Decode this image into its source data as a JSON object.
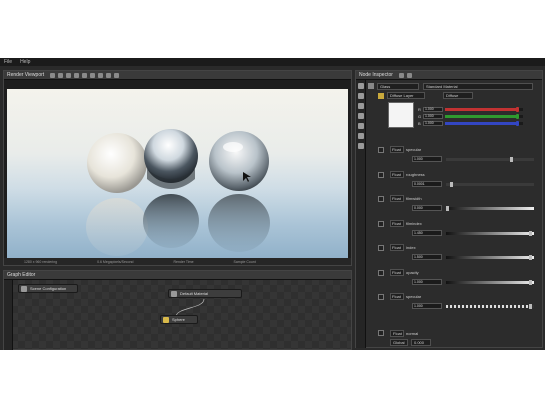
{
  "menu": {
    "items": [
      "File",
      "Help"
    ]
  },
  "viewer": {
    "title": "Render Viewport",
    "status": [
      "1280 x 960 rendering",
      "0.6 Megapixels/Second",
      "Render Time",
      "Sample Count"
    ]
  },
  "graph": {
    "title": "Graph Editor",
    "subtitle": "Scene Configuration",
    "node_a_label": "Default Material",
    "node_b_label": "Sphere"
  },
  "editor": {
    "title": "Node Inspector",
    "preset": "Glass",
    "material_name": "Standard Material",
    "layer_label": "Diffuse Layer",
    "diffuse_mode": "Diffuse",
    "channels": [
      {
        "label": "R",
        "value": "1.000",
        "fill": 0.92,
        "color": "#c23232"
      },
      {
        "label": "G",
        "value": "1.000",
        "fill": 0.92,
        "color": "#2f9a2f"
      },
      {
        "label": "B",
        "value": "1.000",
        "fill": 0.92,
        "color": "#3346c2"
      }
    ],
    "rows": [
      {
        "type": "Float",
        "name": "specular",
        "value": "1.000",
        "level": 0.75,
        "style": "plain"
      },
      {
        "type": "Float",
        "name": "roughness",
        "value": "0.0001",
        "level": 0.05,
        "style": "plain"
      },
      {
        "type": "Float",
        "name": "filmwidth",
        "value": "0.000",
        "level": 0.0,
        "style": "grad"
      },
      {
        "type": "Float",
        "name": "filmindex",
        "value": "1.450",
        "level": 0.98,
        "style": "grad"
      },
      {
        "type": "Float",
        "name": "index",
        "value": "1.500",
        "level": 0.98,
        "style": "grad"
      },
      {
        "type": "Float",
        "name": "opacity",
        "value": "1.000",
        "level": 0.98,
        "style": "grad"
      },
      {
        "type": "Float",
        "name": "specular",
        "value": "1.000",
        "level": 0.98,
        "style": "stripes"
      }
    ],
    "bottom": {
      "type": "Float",
      "name": "normal",
      "select": "Global",
      "field": "0.000"
    }
  },
  "colors": {
    "panel": "#2c2c2c",
    "accent": "#d8b94a"
  }
}
